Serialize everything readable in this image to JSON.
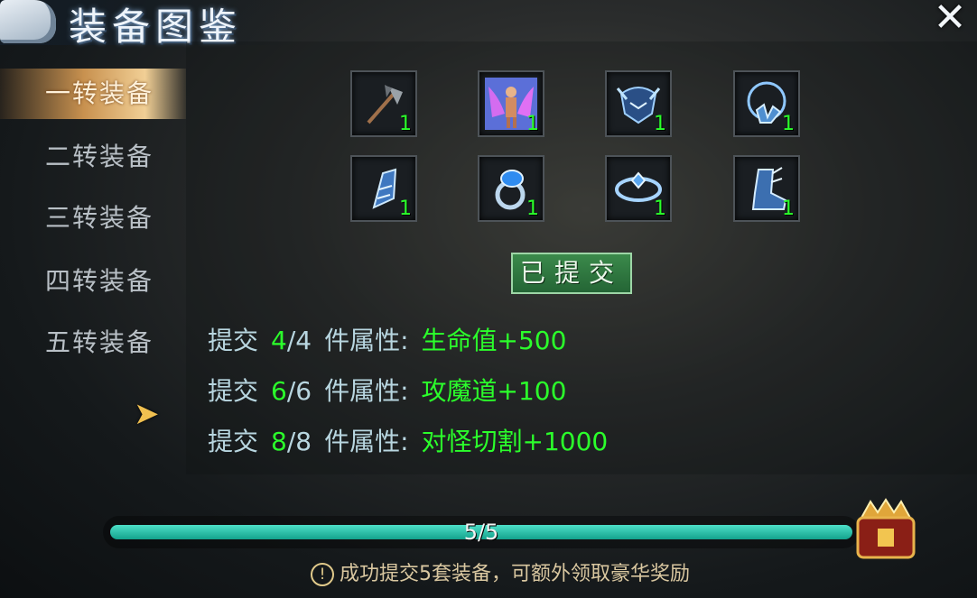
{
  "header": {
    "title": "装备图鉴",
    "close_symbol": "✕"
  },
  "sidebar": {
    "items": [
      {
        "label": "一转装备",
        "active": true
      },
      {
        "label": "二转装备",
        "active": false
      },
      {
        "label": "三转装备",
        "active": false
      },
      {
        "label": "四转装备",
        "active": false
      },
      {
        "label": "五转装备",
        "active": false
      }
    ],
    "more_arrow": "➤"
  },
  "equipment": {
    "slots": [
      {
        "icon": "axe-icon",
        "count": "1"
      },
      {
        "icon": "winged-armor-icon",
        "count": "1"
      },
      {
        "icon": "helmet-icon",
        "count": "1"
      },
      {
        "icon": "necklace-icon",
        "count": "1"
      },
      {
        "icon": "bracer-icon",
        "count": "1"
      },
      {
        "icon": "ring-icon",
        "count": "1"
      },
      {
        "icon": "belt-icon",
        "count": "1"
      },
      {
        "icon": "boots-icon",
        "count": "1"
      }
    ],
    "submitted_label": "已提交"
  },
  "attributes": [
    {
      "prefix": "提交",
      "have": "4",
      "need": "/4",
      "middle": "件属性:",
      "bonus": "生命值+500"
    },
    {
      "prefix": "提交",
      "have": "6",
      "need": "/6",
      "middle": "件属性:",
      "bonus": "攻魔道+100"
    },
    {
      "prefix": "提交",
      "have": "8",
      "need": "/8",
      "middle": "件属性:",
      "bonus": "对怪切割+1000"
    }
  ],
  "progress": {
    "text": "5/5",
    "fraction": 1.0
  },
  "hint": {
    "text": "成功提交5套装备，可额外领取豪华奖励"
  },
  "colors": {
    "green": "#2bff2b",
    "active_tab": "#c8914f",
    "progress": "#13a28c"
  }
}
